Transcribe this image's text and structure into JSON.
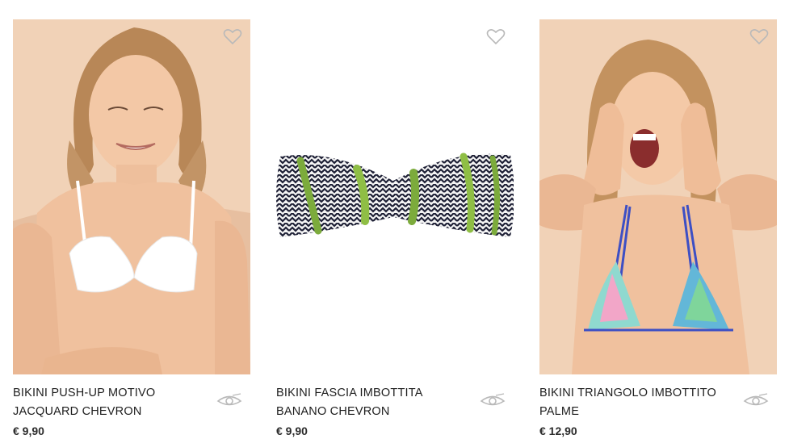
{
  "products": [
    {
      "title": "BIKINI PUSH-UP MOTIVO JACQUARD CHEVRON",
      "price": "€ 9,90",
      "favorite_icon": "heart-icon",
      "quickview_icon": "eye-icon"
    },
    {
      "title": "BIKINI FASCIA IMBOTTITA BANANO CHEVRON",
      "price": "€ 9,90",
      "favorite_icon": "heart-icon",
      "quickview_icon": "eye-icon"
    },
    {
      "title": "BIKINI TRIANGOLO IMBOTTITO PALME",
      "price": "€ 12,90",
      "favorite_icon": "heart-icon",
      "quickview_icon": "eye-icon"
    }
  ],
  "colors": {
    "photo_background": "#f1d2b7",
    "text": "#1e1e1e",
    "icon": "#b9b9b9"
  }
}
